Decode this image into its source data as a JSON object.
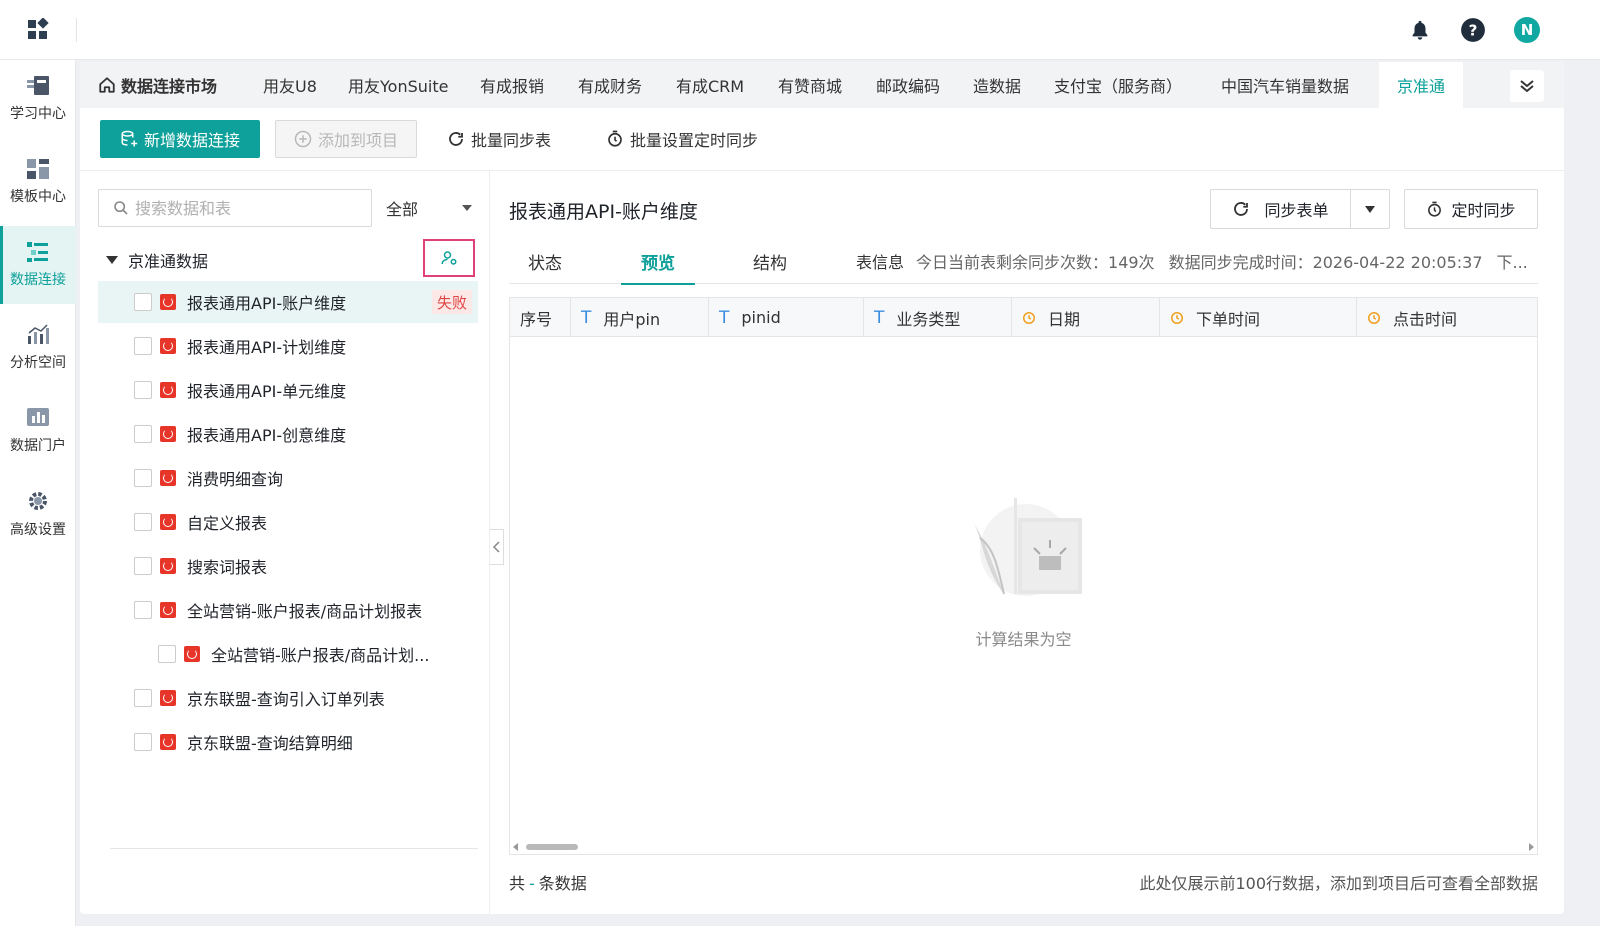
{
  "topbar": {
    "avatar_letter": "N",
    "icons": [
      "apps-grid-icon",
      "bell-icon",
      "help-icon"
    ]
  },
  "sidebar": {
    "items": [
      {
        "label": "学习中心",
        "icon": "learn-icon",
        "active": false
      },
      {
        "label": "模板中心",
        "icon": "template-icon",
        "active": false
      },
      {
        "label": "数据连接",
        "icon": "data-connect-icon",
        "active": true
      },
      {
        "label": "分析空间",
        "icon": "analysis-icon",
        "active": false
      },
      {
        "label": "数据门户",
        "icon": "portal-icon",
        "active": false
      },
      {
        "label": "高级设置",
        "icon": "gear-icon",
        "active": false
      }
    ]
  },
  "tabs": [
    {
      "label": "数据连接市场"
    },
    {
      "label": "用友U8"
    },
    {
      "label": "用友YonSuite"
    },
    {
      "label": "有成报销"
    },
    {
      "label": "有成财务"
    },
    {
      "label": "有成CRM"
    },
    {
      "label": "有赞商城"
    },
    {
      "label": "邮政编码"
    },
    {
      "label": "造数据"
    },
    {
      "label": "支付宝（服务商）"
    },
    {
      "label": "中国汽车销量数据"
    },
    {
      "label": "京准通",
      "active": true
    }
  ],
  "toolbar": {
    "add_connection": "新增数据连接",
    "add_to_project": "添加到项目",
    "batch_sync": "批量同步表",
    "batch_schedule": "批量设置定时同步"
  },
  "left": {
    "search_placeholder": "搜索数据和表",
    "filter_value": "全部",
    "root_label": "京准通数据",
    "items": [
      {
        "name": "报表通用API-账户维度",
        "status": "失败",
        "selected": true
      },
      {
        "name": "报表通用API-计划维度"
      },
      {
        "name": "报表通用API-单元维度"
      },
      {
        "name": "报表通用API-创意维度"
      },
      {
        "name": "消费明细查询"
      },
      {
        "name": "自定义报表"
      },
      {
        "name": "搜索词报表"
      },
      {
        "name": "全站营销-账户报表/商品计划报表"
      },
      {
        "name": "全站营销-账户报表/商品计划...",
        "indent": true
      },
      {
        "name": "京东联盟-查询引入订单列表"
      },
      {
        "name": "京东联盟-查询结算明细"
      }
    ]
  },
  "right": {
    "title": "报表通用API-账户维度",
    "sync_button": "同步表单",
    "timer_button": "定时同步",
    "subtabs": [
      "状态",
      "预览",
      "结构"
    ],
    "active_subtab": "预览",
    "table_info_label": "表信息",
    "remaining_sync": "今日当前表剩余同步次数：149次",
    "sync_time": "数据同步完成时间：2026-04-22 20:05:37",
    "more": "下...",
    "columns": [
      {
        "label": "序号",
        "type": "none"
      },
      {
        "label": "用户pin",
        "type": "text"
      },
      {
        "label": "pinid",
        "type": "text"
      },
      {
        "label": "业务类型",
        "type": "text"
      },
      {
        "label": "日期",
        "type": "time"
      },
      {
        "label": "下单时间",
        "type": "time"
      },
      {
        "label": "点击时间",
        "type": "time"
      }
    ],
    "type_text_glyph": "T",
    "empty_text": "计算结果为空",
    "footer_total_prefix": "共",
    "footer_total_value": "-",
    "footer_total_suffix": "条数据",
    "footer_note": "此处仅展示前100行数据，添加到项目后可查看全部数据"
  },
  "colors": {
    "accent": "#0ea09a",
    "fail_badge": "#e04545",
    "file_icon": "#e8352a",
    "highlight_border": "#e0407a"
  }
}
